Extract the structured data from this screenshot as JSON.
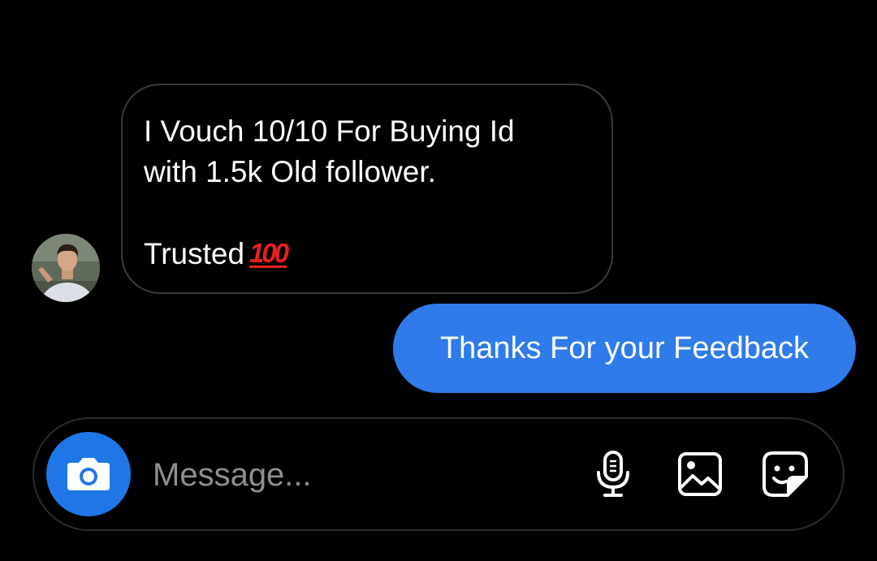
{
  "conversation": {
    "incoming": {
      "lines": [
        "I Vouch 10/10 For Buying Id",
        "with 1.5k Old follower.",
        "",
        "Trusted"
      ],
      "emoji": "💯",
      "emoji_icon": "hundred-points-icon",
      "avatar_icon": "user-avatar"
    },
    "outgoing": {
      "text": "Thanks For your Feedback",
      "bubble_color": "#2f7bea"
    }
  },
  "composer": {
    "placeholder": "Message...",
    "camera_icon": "camera-icon",
    "camera_button_color": "#1f77e7",
    "mic_icon": "microphone-icon",
    "gallery_icon": "gallery-icon",
    "sticker_icon": "sticker-icon"
  },
  "theme": {
    "background": "#000000",
    "bubble_border": "#3a3a3c",
    "text": "#ffffff",
    "placeholder": "#8e8e93"
  }
}
